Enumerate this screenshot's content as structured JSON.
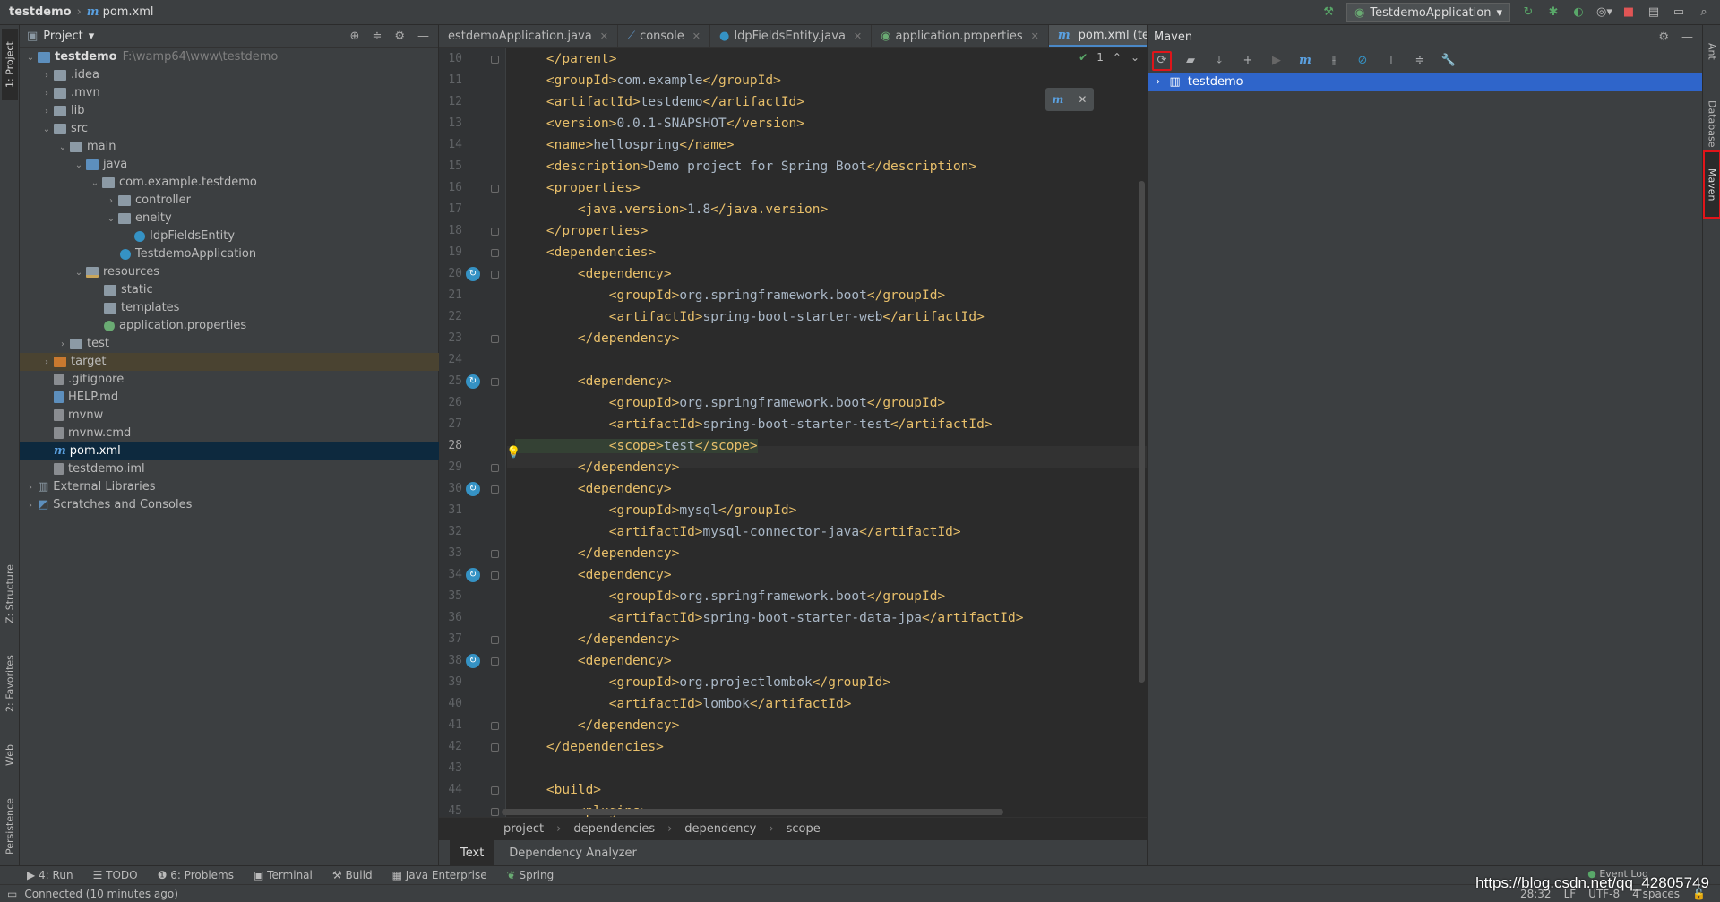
{
  "title_bar": {
    "project": "testdemo",
    "file": "pom.xml",
    "run_config": "TestdemoApplication"
  },
  "left_stripe": {
    "project": "1: Project",
    "structure": "Z: Structure",
    "favorites": "2: Favorites",
    "web": "Web",
    "persistence": "Persistence"
  },
  "project_panel": {
    "title": "Project",
    "items": [
      {
        "label": "testdemo",
        "path": "F:\\wamp64\\www\\testdemo"
      },
      {
        "label": ".idea"
      },
      {
        "label": ".mvn"
      },
      {
        "label": "lib"
      },
      {
        "label": "src"
      },
      {
        "label": "main"
      },
      {
        "label": "java"
      },
      {
        "label": "com.example.testdemo"
      },
      {
        "label": "controller"
      },
      {
        "label": "eneity"
      },
      {
        "label": "IdpFieldsEntity"
      },
      {
        "label": "TestdemoApplication"
      },
      {
        "label": "resources"
      },
      {
        "label": "static"
      },
      {
        "label": "templates"
      },
      {
        "label": "application.properties"
      },
      {
        "label": "test"
      },
      {
        "label": "target"
      },
      {
        "label": ".gitignore"
      },
      {
        "label": "HELP.md"
      },
      {
        "label": "mvnw"
      },
      {
        "label": "mvnw.cmd"
      },
      {
        "label": "pom.xml"
      },
      {
        "label": "testdemo.iml"
      },
      {
        "label": "External Libraries"
      },
      {
        "label": "Scratches and Consoles"
      }
    ]
  },
  "tabs": [
    {
      "label": "estdemoApplication.java"
    },
    {
      "label": "console"
    },
    {
      "label": "IdpFieldsEntity.java"
    },
    {
      "label": "application.properties"
    },
    {
      "label": "pom.xml (testdemo)"
    }
  ],
  "editor": {
    "inspection_count": "1",
    "lines": [
      {
        "n": "10",
        "code": "    </parent>"
      },
      {
        "n": "11",
        "code": "    <groupId>com.example</groupId>"
      },
      {
        "n": "12",
        "code": "    <artifactId>testdemo</artifactId>"
      },
      {
        "n": "13",
        "code": "    <version>0.0.1-SNAPSHOT</version>"
      },
      {
        "n": "14",
        "code": "    <name>hellospring</name>"
      },
      {
        "n": "15",
        "code": "    <description>Demo project for Spring Boot</description>"
      },
      {
        "n": "16",
        "code": "    <properties>"
      },
      {
        "n": "17",
        "code": "        <java.version>1.8</java.version>"
      },
      {
        "n": "18",
        "code": "    </properties>"
      },
      {
        "n": "19",
        "code": "    <dependencies>"
      },
      {
        "n": "20",
        "code": "        <dependency>"
      },
      {
        "n": "21",
        "code": "            <groupId>org.springframework.boot</groupId>"
      },
      {
        "n": "22",
        "code": "            <artifactId>spring-boot-starter-web</artifactId>"
      },
      {
        "n": "23",
        "code": "        </dependency>"
      },
      {
        "n": "24",
        "code": ""
      },
      {
        "n": "25",
        "code": "        <dependency>"
      },
      {
        "n": "26",
        "code": "            <groupId>org.springframework.boot</groupId>"
      },
      {
        "n": "27",
        "code": "            <artifactId>spring-boot-starter-test</artifactId>"
      },
      {
        "n": "28",
        "code": "            <scope>test</scope>"
      },
      {
        "n": "29",
        "code": "        </dependency>"
      },
      {
        "n": "30",
        "code": "        <dependency>"
      },
      {
        "n": "31",
        "code": "            <groupId>mysql</groupId>"
      },
      {
        "n": "32",
        "code": "            <artifactId>mysql-connector-java</artifactId>"
      },
      {
        "n": "33",
        "code": "        </dependency>"
      },
      {
        "n": "34",
        "code": "        <dependency>"
      },
      {
        "n": "35",
        "code": "            <groupId>org.springframework.boot</groupId>"
      },
      {
        "n": "36",
        "code": "            <artifactId>spring-boot-starter-data-jpa</artifactId>"
      },
      {
        "n": "37",
        "code": "        </dependency>"
      },
      {
        "n": "38",
        "code": "        <dependency>"
      },
      {
        "n": "39",
        "code": "            <groupId>org.projectlombok</groupId>"
      },
      {
        "n": "40",
        "code": "            <artifactId>lombok</artifactId>"
      },
      {
        "n": "41",
        "code": "        </dependency>"
      },
      {
        "n": "42",
        "code": "    </dependencies>"
      },
      {
        "n": "43",
        "code": ""
      },
      {
        "n": "44",
        "code": "    <build>"
      },
      {
        "n": "45",
        "code": "        <plugins>"
      }
    ]
  },
  "breadcrumbs": [
    "project",
    "dependencies",
    "dependency",
    "scope"
  ],
  "editor_bottom_tabs": {
    "text": "Text",
    "analyzer": "Dependency Analyzer"
  },
  "maven_panel": {
    "title": "Maven",
    "tree_root": "testdemo"
  },
  "right_stripe": {
    "ant": "Ant",
    "database": "Database",
    "maven": "Maven"
  },
  "bottom_tools": [
    {
      "label": "4: Run"
    },
    {
      "label": "TODO"
    },
    {
      "label": "6: Problems"
    },
    {
      "label": "Terminal"
    },
    {
      "label": "Build"
    },
    {
      "label": "Java Enterprise"
    },
    {
      "label": "Spring"
    }
  ],
  "event_log": "Event Log",
  "status": {
    "message": "Connected (10 minutes ago)",
    "position": "28:32",
    "line_sep": "LF",
    "encoding": "UTF-8",
    "indent": "4 spaces"
  },
  "watermark": "https://blog.csdn.net/qq_42805749"
}
